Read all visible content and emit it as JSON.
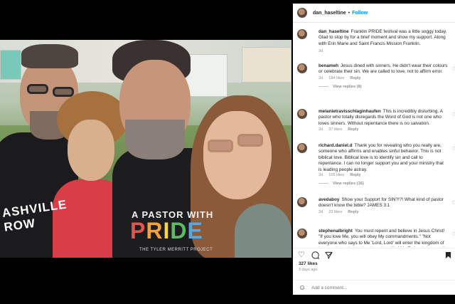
{
  "photo": {
    "shirt_left_text": "ASHVILLE\nROW",
    "pride_top": "A PASTOR WITH",
    "pride_letters": [
      {
        "ch": "P",
        "color": "#e0554d"
      },
      {
        "ch": "R",
        "color": "#f2a23a"
      },
      {
        "ch": "I",
        "color": "#f5d547"
      },
      {
        "ch": "D",
        "color": "#5dbb63"
      },
      {
        "ch": "E",
        "color": "#5aa6e0"
      }
    ],
    "pride_sub": "THE TYLER MERRITT PROJECT"
  },
  "header": {
    "username": "dan_haseltine",
    "separator": "•",
    "follow": "Follow"
  },
  "caption": {
    "username": "dan_haseltine",
    "text": "Franklin PRIDE festival was a little soggy today. Glad to stop by for a brief moment and show my support. Along with Erin Marie and Saint Francis Mission Franklin.",
    "time": "3d"
  },
  "comments": [
    {
      "username": "benameh",
      "text": "Jesus dined with sinners. He didn't wear their colours or celebrate their sin. We are called to love, not to affirm error.",
      "time": "2d",
      "likes": "184 likes",
      "reply": "Reply",
      "replies": "View replies (8)"
    },
    {
      "username": "melanietravisschlaginhaufen",
      "text": "This is incredibly disturbing. A pastor who totally disregards the Word of God is not one who loves sinners. Without repentance there is no salvation.",
      "time": "2d",
      "likes": "37 likes",
      "reply": "Reply",
      "replies": ""
    },
    {
      "username": "richard.daniel.d",
      "text": "Thank you for revealing who you really are, someone who affirms and enables sinful behavior. This is not biblical love. Biblical love is to identify sin and call to repentance. I can no longer support you and your ministry that is leading people astray.",
      "time": "2d",
      "likes": "105 likes",
      "reply": "Reply",
      "replies": "View replies (16)"
    },
    {
      "username": "avedaboy",
      "text": "Show your Support for SIN?!?! What kind of pastor doesn't know the bible? JAMES 3:1",
      "time": "2d",
      "likes": "22 likes",
      "reply": "Reply",
      "replies": ""
    },
    {
      "username": "stephenalbright",
      "text": "You must repent and believe in Jesus Christ! \"If you love Me, you will obey My commandments.\" \"Not everyone who says to Me 'Lord, Lord' will enter the kingdom of heaven, but only he who does the will of My Father in heaven.\"",
      "time": "",
      "likes": "",
      "reply": "",
      "replies": ""
    }
  ],
  "footer": {
    "likes": "327 likes",
    "date": "3 days ago",
    "add_comment_placeholder": "Add a comment..."
  },
  "icons": {
    "like": "heart-icon",
    "comment": "comment-icon",
    "share": "share-icon",
    "save": "bookmark-icon",
    "emoji": "emoji-icon"
  }
}
